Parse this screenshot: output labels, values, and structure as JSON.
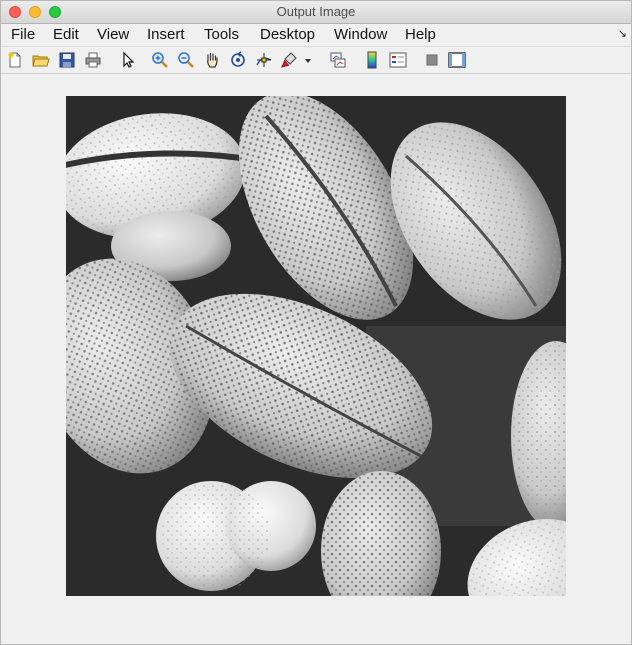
{
  "window": {
    "title": "Output Image",
    "controls": [
      "close",
      "minimize",
      "zoom"
    ]
  },
  "menubar": {
    "items": [
      "File",
      "Edit",
      "View",
      "Insert",
      "Tools",
      "Desktop",
      "Window",
      "Help"
    ]
  },
  "toolbar": {
    "icons": [
      "new-figure-icon",
      "open-file-icon",
      "save-icon",
      "print-icon",
      "pointer-icon",
      "zoom-in-icon",
      "zoom-out-icon",
      "pan-icon",
      "rotate-3d-icon",
      "data-cursor-icon",
      "brush-icon",
      "dropdown-arrow-icon",
      "link-plot-icon",
      "colorbar-icon",
      "legend-icon",
      "hide-plot-tools-icon",
      "show-plot-tools-icon"
    ]
  },
  "figure": {
    "image": "grayscale-pollen-grains"
  }
}
